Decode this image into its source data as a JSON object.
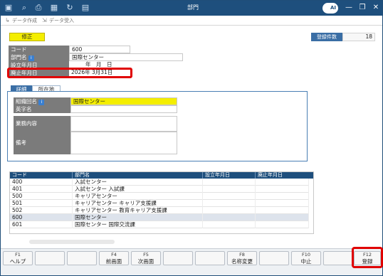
{
  "window": {
    "title": "部門",
    "logo_text": "AI",
    "minimize_glyph": "—",
    "restore_glyph": "❐",
    "close_glyph": "✕"
  },
  "toolbar": {
    "create_data_label": "データ作成",
    "import_data_label": "データ受入"
  },
  "mode_badge": "修正",
  "record_count": {
    "label": "登録件数",
    "value": "18"
  },
  "fields": {
    "code": {
      "label": "コード",
      "value": "600"
    },
    "dept_name": {
      "label": "部門名",
      "value": "国際センター"
    },
    "established": {
      "label": "設立年月日",
      "year": "年",
      "month": "月",
      "day": "日"
    },
    "abolished": {
      "label": "廃止年月日",
      "value": "2026年 3月31日"
    }
  },
  "tabs": {
    "detail": "詳細",
    "location": "所在地"
  },
  "detail": {
    "org_name": {
      "label": "組織回名",
      "value": "国際センター"
    },
    "english_name": {
      "label": "英字名",
      "value": ""
    },
    "business": {
      "label": "業務内容",
      "value": ""
    },
    "remarks": {
      "label": "備考",
      "value": ""
    }
  },
  "grid": {
    "headers": [
      "コード",
      "部門名",
      "設立年月日",
      "廃止年月日"
    ],
    "rows": [
      {
        "code": "400",
        "name": "入試センター",
        "est": "",
        "abol": ""
      },
      {
        "code": "401",
        "name": "入試センター 入試課",
        "est": "",
        "abol": ""
      },
      {
        "code": "500",
        "name": "キャリアセンター",
        "est": "",
        "abol": ""
      },
      {
        "code": "501",
        "name": "キャリアセンター キャリア支援課",
        "est": "",
        "abol": ""
      },
      {
        "code": "502",
        "name": "キャリアセンター 教育キャリア支援課",
        "est": "",
        "abol": ""
      },
      {
        "code": "600",
        "name": "国際センター",
        "est": "",
        "abol": ""
      },
      {
        "code": "601",
        "name": "国際センター 国際交流課",
        "est": "",
        "abol": ""
      }
    ]
  },
  "fkeys": [
    {
      "code": "F1",
      "label": "ヘルプ"
    },
    {
      "code": "",
      "label": ""
    },
    {
      "code": "",
      "label": ""
    },
    {
      "code": "F4",
      "label": "前画面"
    },
    {
      "code": "F5",
      "label": "次画面"
    },
    {
      "code": "",
      "label": ""
    },
    {
      "code": "",
      "label": ""
    },
    {
      "code": "F8",
      "label": "名称変更"
    },
    {
      "code": "",
      "label": ""
    },
    {
      "code": "F10",
      "label": "中止"
    },
    {
      "code": "",
      "label": ""
    },
    {
      "code": "F12",
      "label": "登録"
    }
  ],
  "colors": {
    "titlebar": "#1e4f7d",
    "mode_badge": "#f4ee00",
    "highlight_box": "#e00000",
    "selected_row": "#dde3ec"
  }
}
